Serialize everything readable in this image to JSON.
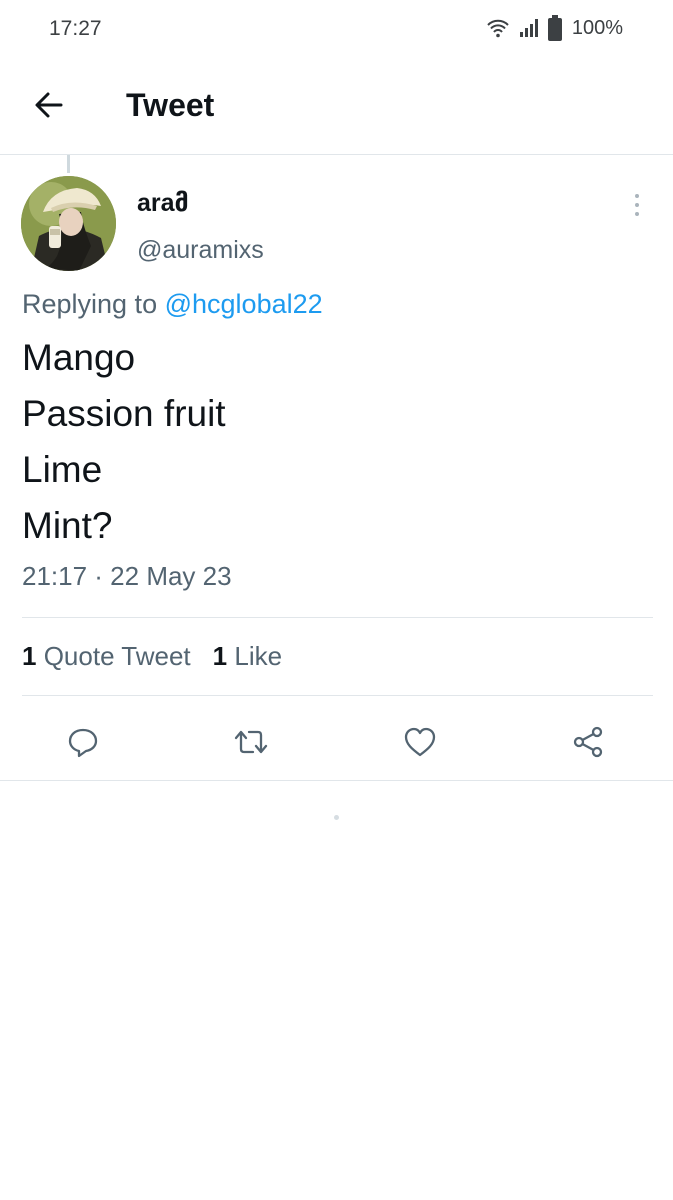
{
  "status_bar": {
    "time": "17:27",
    "battery": "100%",
    "icons": [
      "wifi-icon",
      "signal-icon",
      "battery-icon"
    ]
  },
  "header": {
    "title": "Tweet",
    "back_icon": "arrow-left-icon"
  },
  "tweet": {
    "display_name": "araმ",
    "handle": "@auramixs",
    "replying_prefix": "Replying to",
    "replying_to": "@hcglobal22",
    "lines": [
      "Mango",
      "Passion fruit",
      "Lime",
      "Mint?"
    ],
    "timestamp": "21:17 · 22 May 23",
    "stats": [
      {
        "count": "1",
        "label": "Quote Tweet"
      },
      {
        "count": "1",
        "label": "Like"
      }
    ],
    "actions": [
      "reply-icon",
      "retweet-icon",
      "like-icon",
      "share-icon"
    ],
    "more_icon": "more-vertical-icon"
  },
  "colors": {
    "text_primary": "#0f1419",
    "text_secondary": "#536471",
    "link": "#1d9bf0",
    "divider": "#e1e6ea",
    "action_icon": "#536471"
  }
}
